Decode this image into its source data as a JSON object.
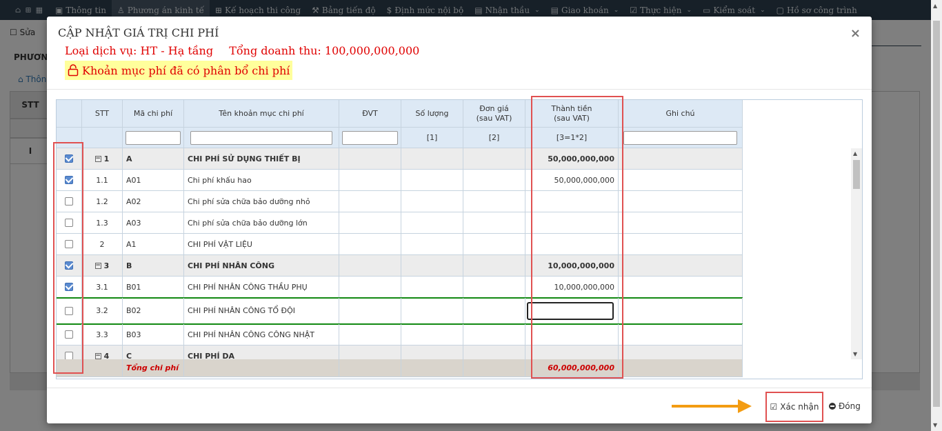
{
  "topnav": {
    "items": [
      {
        "label": "Thông tin",
        "icon": "info-icon"
      },
      {
        "label": "Phương án kinh tế",
        "icon": "user-icon",
        "active": true
      },
      {
        "label": "Kế hoạch thi công",
        "icon": "grid-icon"
      },
      {
        "label": "Bảng tiến độ",
        "icon": "wrench-icon"
      },
      {
        "label": "Định mức nội bộ",
        "icon": "dollar-icon"
      },
      {
        "label": "Nhận thầu",
        "icon": "doc-icon",
        "caret": true
      },
      {
        "label": "Giao khoán",
        "icon": "doc-icon",
        "caret": true
      },
      {
        "label": "Thực hiện",
        "icon": "check-icon",
        "caret": true
      },
      {
        "label": "Kiểm soát",
        "icon": "monitor-icon",
        "caret": true
      },
      {
        "label": "Hồ sơ công trình",
        "icon": "briefcase-icon"
      }
    ]
  },
  "background": {
    "edit_label": "Sửa",
    "page_title": "PHƯƠNG",
    "crumb": "Thôn",
    "col_stt": "STT",
    "row_label": "I"
  },
  "modal": {
    "title": "CẬP NHẬT GIÁ TRỊ CHI PHÍ",
    "service_type": "Loại dịch vụ: HT - Hạ tầng",
    "total_revenue": "Tổng doanh thu: 100,000,000,000",
    "allocation_note": "Khoản mục phí đã có phân bổ chi phí",
    "columns": {
      "stt": "STT",
      "code": "Mã chi phí",
      "name": "Tên khoản mục chi phí",
      "unit": "ĐVT",
      "qty": "Số lượng",
      "price_1": "Đơn giá",
      "price_2": "(sau VAT)",
      "amount_1": "Thành tiền",
      "amount_2": "(sau VAT)",
      "note": "Ghi chú"
    },
    "filters": {
      "qty": "[1]",
      "price": "[2]",
      "amount": "[3=1*2]"
    },
    "rows": [
      {
        "checked": true,
        "stt": "1",
        "code": "A",
        "name": "CHI PHÍ SỬ DỤNG THIẾT BỊ",
        "amount": "50,000,000,000",
        "group": true
      },
      {
        "checked": true,
        "stt": "1.1",
        "code": "A01",
        "name": "Chi phí khấu hao",
        "amount": "50,000,000,000",
        "group": false
      },
      {
        "checked": false,
        "stt": "1.2",
        "code": "A02",
        "name": "Chi phí sửa chữa bảo dưỡng nhỏ",
        "amount": "",
        "group": false
      },
      {
        "checked": false,
        "stt": "1.3",
        "code": "A03",
        "name": "Chi phí sửa chữa bảo dưỡng lớn",
        "amount": "",
        "group": false
      },
      {
        "checked": false,
        "stt": "2",
        "code": "A1",
        "name": "CHI PHÍ VẬT LIỆU",
        "amount": "",
        "group": false
      },
      {
        "checked": true,
        "stt": "3",
        "code": "B",
        "name": "CHI PHÍ NHÂN CÔNG",
        "amount": "10,000,000,000",
        "group": true
      },
      {
        "checked": true,
        "stt": "3.1",
        "code": "B01",
        "name": "CHI PHÍ NHÂN CÔNG THẦU PHỤ",
        "amount": "10,000,000,000",
        "group": false
      },
      {
        "checked": false,
        "stt": "3.2",
        "code": "B02",
        "name": "CHI PHÍ NHÂN CÔNG TỔ ĐỘI",
        "amount": "",
        "group": false,
        "editing": true
      },
      {
        "checked": false,
        "stt": "3.3",
        "code": "B03",
        "name": "CHI PHÍ NHÂN CÔNG CÔNG NHẬT",
        "amount": "",
        "group": false
      },
      {
        "checked": false,
        "stt": "4",
        "code": "C",
        "name": "CHI PHÍ DA",
        "amount": "",
        "group": true
      }
    ],
    "footer": {
      "label": "Tổng chi phí",
      "total": "60,000,000,000"
    },
    "buttons": {
      "confirm": "Xác nhận",
      "close": "Đóng"
    }
  },
  "colors": {
    "nav_bg": "#2f4050",
    "alert_red": "#e00000",
    "highlight_yellow": "#ffff9c",
    "header_blue": "#dde9f5",
    "annotation_red": "#e05050",
    "arrow_orange": "#f39c12"
  }
}
